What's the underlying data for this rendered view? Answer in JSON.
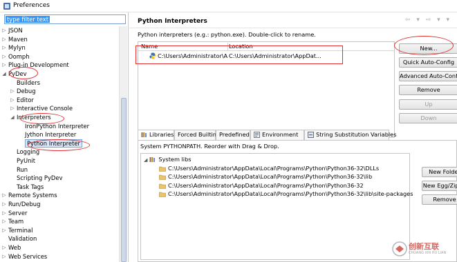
{
  "window": {
    "title": "Preferences"
  },
  "filter": {
    "value": "type filter text"
  },
  "tree": {
    "items": [
      {
        "label": "JSON",
        "level": 0,
        "toggle": "▷"
      },
      {
        "label": "Maven",
        "level": 0,
        "toggle": "▷"
      },
      {
        "label": "Mylyn",
        "level": 0,
        "toggle": "▷"
      },
      {
        "label": "Oomph",
        "level": 0,
        "toggle": "▷"
      },
      {
        "label": "Plug-in Development",
        "level": 0,
        "toggle": "▷"
      },
      {
        "label": "PyDev",
        "level": 0,
        "toggle": "◢"
      },
      {
        "label": "Builders",
        "level": 1,
        "toggle": ""
      },
      {
        "label": "Debug",
        "level": 1,
        "toggle": "▷"
      },
      {
        "label": "Editor",
        "level": 1,
        "toggle": "▷"
      },
      {
        "label": "Interactive Console",
        "level": 1,
        "toggle": "▷"
      },
      {
        "label": "Interpreters",
        "level": 1,
        "toggle": "◢"
      },
      {
        "label": "IronPython Interpreter",
        "level": 2,
        "toggle": ""
      },
      {
        "label": "Jython Interpreter",
        "level": 2,
        "toggle": ""
      },
      {
        "label": "Python Interpreter",
        "level": 2,
        "toggle": "",
        "selected": true
      },
      {
        "label": "Logging",
        "level": 1,
        "toggle": ""
      },
      {
        "label": "PyUnit",
        "level": 1,
        "toggle": ""
      },
      {
        "label": "Run",
        "level": 1,
        "toggle": ""
      },
      {
        "label": "Scripting PyDev",
        "level": 1,
        "toggle": ""
      },
      {
        "label": "Task Tags",
        "level": 1,
        "toggle": ""
      },
      {
        "label": "Remote Systems",
        "level": 0,
        "toggle": "▷"
      },
      {
        "label": "Run/Debug",
        "level": 0,
        "toggle": "▷"
      },
      {
        "label": "Server",
        "level": 0,
        "toggle": "▷"
      },
      {
        "label": "Team",
        "level": 0,
        "toggle": "▷"
      },
      {
        "label": "Terminal",
        "level": 0,
        "toggle": "▷"
      },
      {
        "label": "Validation",
        "level": 0,
        "toggle": ""
      },
      {
        "label": "Web",
        "level": 0,
        "toggle": "▷"
      },
      {
        "label": "Web Services",
        "level": 0,
        "toggle": "▷"
      }
    ]
  },
  "page": {
    "title": "Python Interpreters",
    "nav": "⇦ ▾ ⇨ ▾ ▾",
    "description": "Python interpreters (e.g.: python.exe).   Double-click to rename."
  },
  "interpreters": {
    "columns": [
      "Name",
      "Location"
    ],
    "rows": [
      {
        "name": "C:\\Users\\Administrator\\Ap",
        "location": "C:\\Users\\Administrator\\AppDat..."
      }
    ]
  },
  "buttons": {
    "new": "New...",
    "quick_auto": "Quick Auto-Config",
    "advanced_auto": "Advanced Auto-Config",
    "remove": "Remove",
    "up": "Up",
    "down": "Down"
  },
  "tabs": [
    {
      "label": "Libraries",
      "icon": "libraries-icon",
      "active": true
    },
    {
      "label": "Forced Builtins",
      "icon": "",
      "active": false
    },
    {
      "label": "Predefined",
      "icon": "",
      "active": false
    },
    {
      "label": "Environment",
      "icon": "environment-icon",
      "active": false
    },
    {
      "label": "String Substitution Variables",
      "icon": "variables-icon",
      "active": false
    }
  ],
  "libraries": {
    "description": "System PYTHONPATH.   Reorder with Drag & Drop.",
    "root": "System libs",
    "paths": [
      "C:\\Users\\Administrator\\AppData\\Local\\Programs\\Python\\Python36-32\\DLLs",
      "C:\\Users\\Administrator\\AppData\\Local\\Programs\\Python\\Python36-32\\lib",
      "C:\\Users\\Administrator\\AppData\\Local\\Programs\\Python\\Python36-32",
      "C:\\Users\\Administrator\\AppData\\Local\\Programs\\Python\\Python36-32\\lib\\site-packages"
    ],
    "buttons": {
      "new_folder": "New Folder",
      "new_egg": "New Egg/Zip(s)",
      "remove": "Remove"
    }
  },
  "watermark": {
    "text": "创新互联",
    "sub": "CHUANG XIN HU LIAN"
  }
}
